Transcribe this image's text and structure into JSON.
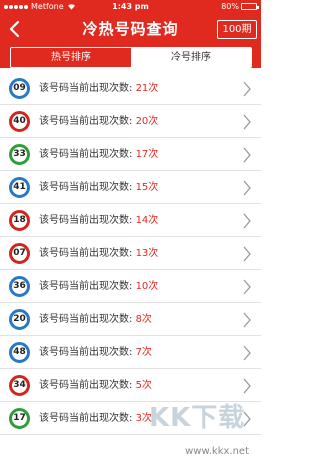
{
  "status": {
    "carrier": "Metfone",
    "time": "1:43 pm",
    "battery": "80%",
    "battery_level": 0.8
  },
  "nav": {
    "title": "冷热号码查询",
    "period": "100期"
  },
  "tabs": [
    {
      "label": "热号排序",
      "active": true
    },
    {
      "label": "冷号排序",
      "active": false
    }
  ],
  "row_prefix": "该号码当前出现次数: ",
  "rows": [
    {
      "number": "09",
      "count": "21次",
      "color": "#2a78c8"
    },
    {
      "number": "40",
      "count": "20次",
      "color": "#d0261e"
    },
    {
      "number": "33",
      "count": "17次",
      "color": "#2e9e3a"
    },
    {
      "number": "41",
      "count": "15次",
      "color": "#2a78c8"
    },
    {
      "number": "18",
      "count": "14次",
      "color": "#d0261e"
    },
    {
      "number": "07",
      "count": "13次",
      "color": "#d0261e"
    },
    {
      "number": "36",
      "count": "10次",
      "color": "#2a78c8"
    },
    {
      "number": "20",
      "count": "8次",
      "color": "#2a78c8"
    },
    {
      "number": "48",
      "count": "7次",
      "color": "#2a78c8"
    },
    {
      "number": "34",
      "count": "5次",
      "color": "#d0261e"
    },
    {
      "number": "17",
      "count": "3次",
      "color": "#2e9e3a"
    }
  ],
  "watermark": {
    "logo_text": "KK下载",
    "url": "www.kkx.net"
  },
  "colors": {
    "accent": "#e02a20",
    "count": "#e02a20"
  }
}
